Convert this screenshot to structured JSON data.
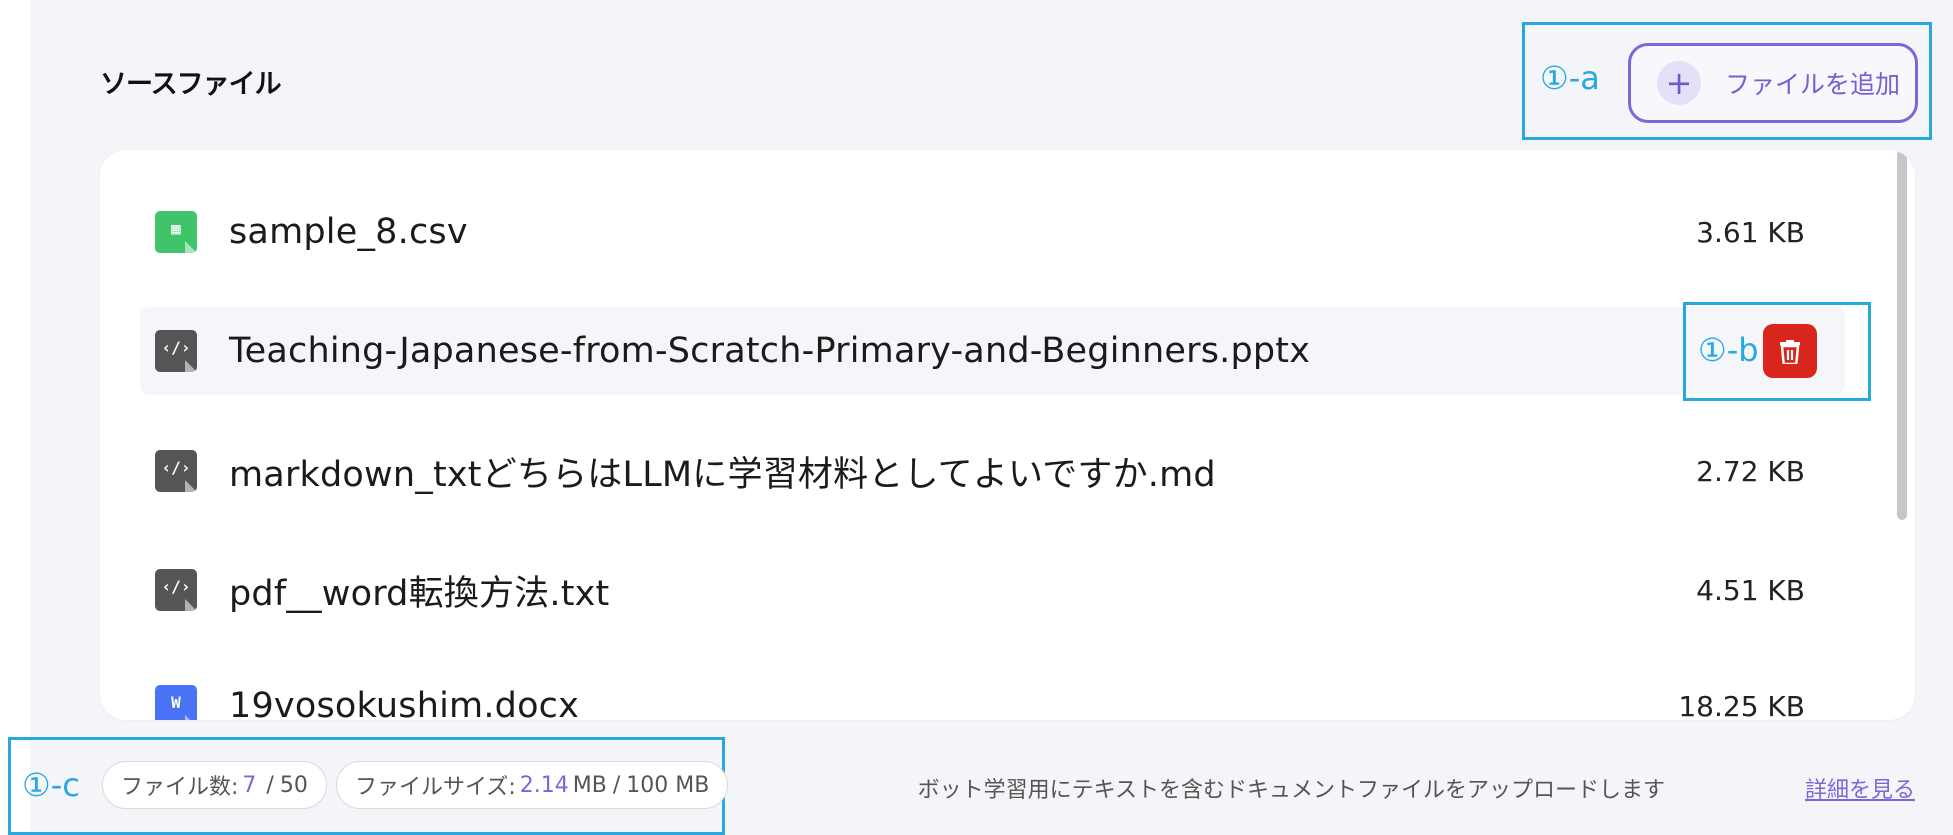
{
  "section": {
    "title": "ソースファイル"
  },
  "add_button": {
    "label": "ファイルを追加",
    "icon": "plus-icon"
  },
  "annotations": {
    "a": "①-a",
    "b": "①-b",
    "c": "①-c"
  },
  "files": [
    {
      "name": "sample_8.csv",
      "size": "3.61 KB",
      "icon": "csv-file-icon",
      "color": "#3fc46a"
    },
    {
      "name": "Teaching-Japanese-from-Scratch-Primary-and-Beginners.pptx",
      "size": "",
      "icon": "code-file-icon",
      "color": "#555555"
    },
    {
      "name": "markdown_txtどちらはLLMに学習材料としてよいですか.md",
      "size": "2.72 KB",
      "icon": "code-file-icon",
      "color": "#555555"
    },
    {
      "name": "pdf__word転換方法.txt",
      "size": "4.51 KB",
      "icon": "code-file-icon",
      "color": "#555555"
    },
    {
      "name": "19vosokushim.docx",
      "size": "18.25 KB",
      "icon": "word-file-icon",
      "color": "#4a72f5"
    }
  ],
  "footer": {
    "file_count_label": "ファイル数:",
    "file_count_value": "7",
    "file_count_sep": "/",
    "file_count_max": "50",
    "file_size_label": "ファイルサイズ:",
    "file_size_value": "2.14",
    "file_size_unit": "MB",
    "file_size_sep": "/",
    "file_size_max": "100 MB",
    "hint": "ボット学習用にテキストを含むドキュメントファイルをアップロードします",
    "link": "詳細を見る"
  },
  "colors": {
    "accent": "#7a68d8",
    "danger": "#d8261c",
    "annotation": "#29a8e0"
  }
}
